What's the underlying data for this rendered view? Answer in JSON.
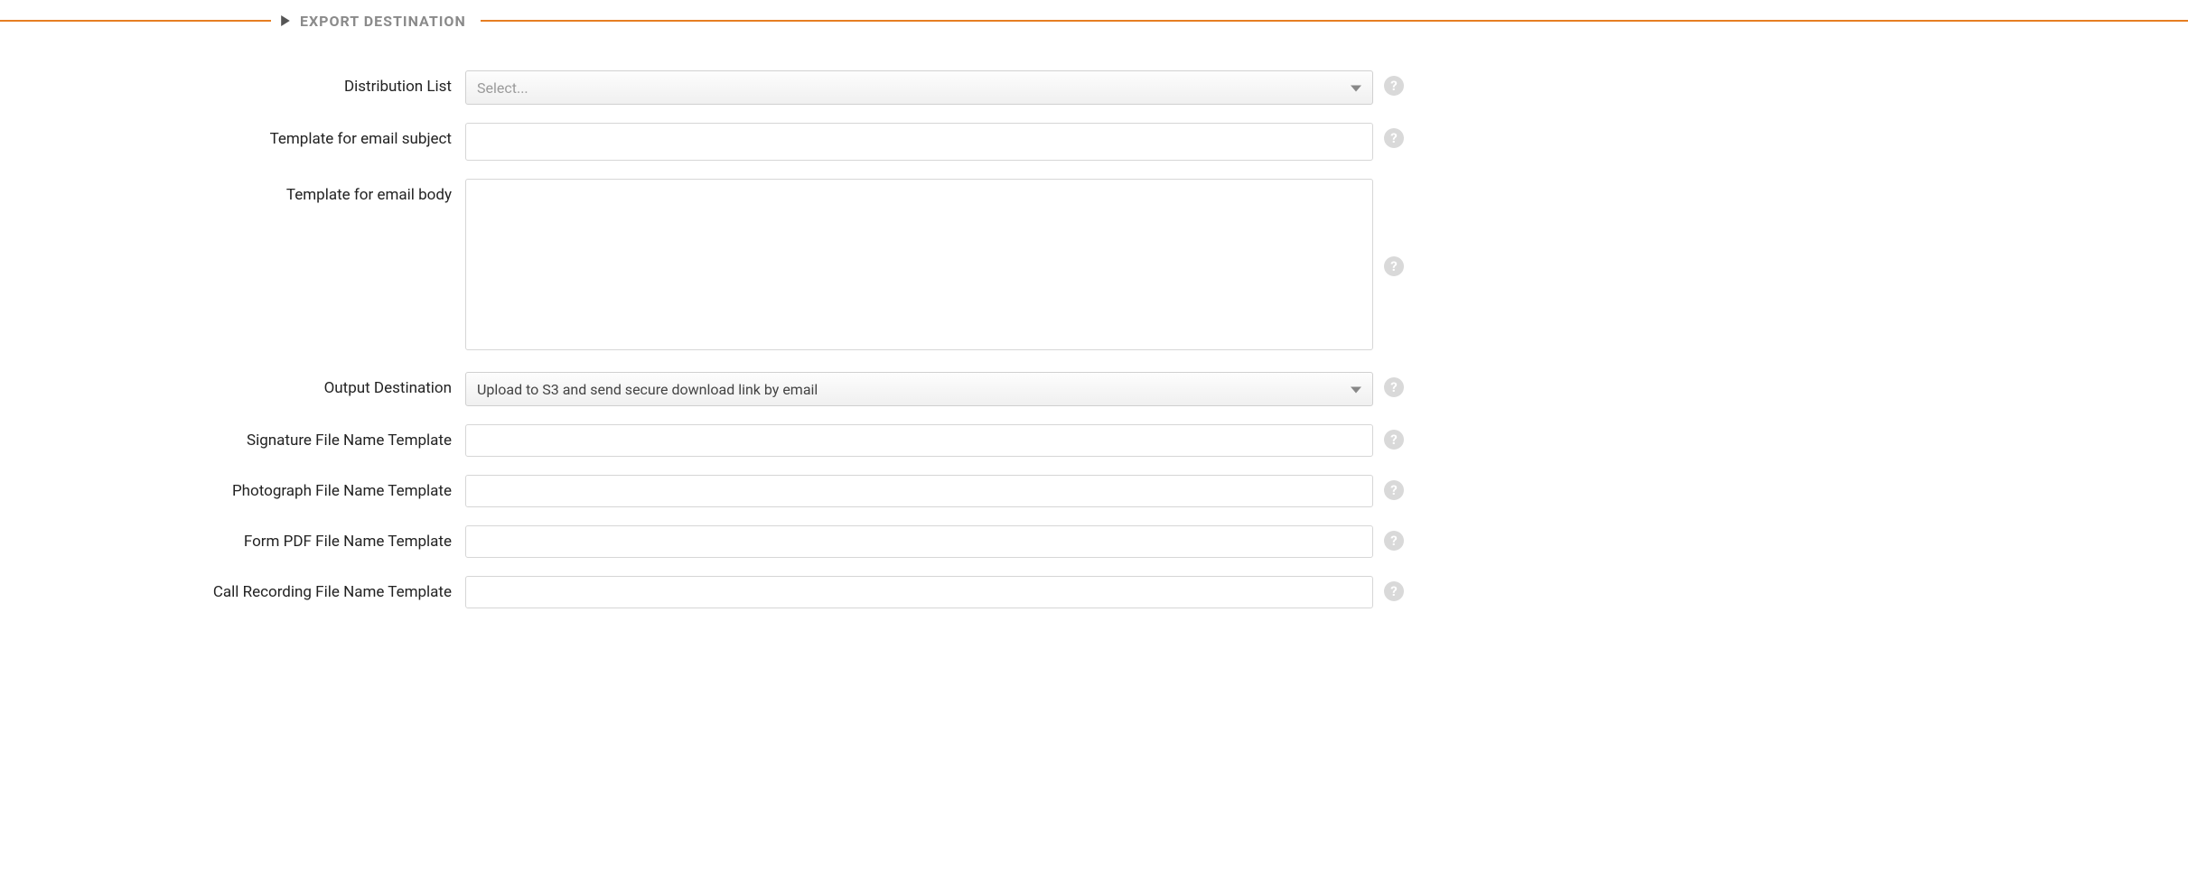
{
  "section": {
    "title": "EXPORT DESTINATION"
  },
  "fields": {
    "distribution_list": {
      "label": "Distribution List",
      "placeholder": "Select...",
      "value": ""
    },
    "email_subject": {
      "label": "Template for email subject",
      "value": ""
    },
    "email_body": {
      "label": "Template for email body",
      "value": ""
    },
    "output_destination": {
      "label": "Output Destination",
      "value": "Upload to S3 and send secure download link by email"
    },
    "signature_template": {
      "label": "Signature File Name Template",
      "value": ""
    },
    "photograph_template": {
      "label": "Photograph File Name Template",
      "value": ""
    },
    "form_pdf_template": {
      "label": "Form PDF File Name Template",
      "value": ""
    },
    "call_recording_template": {
      "label": "Call Recording File Name Template",
      "value": ""
    }
  },
  "help_glyph": "?"
}
